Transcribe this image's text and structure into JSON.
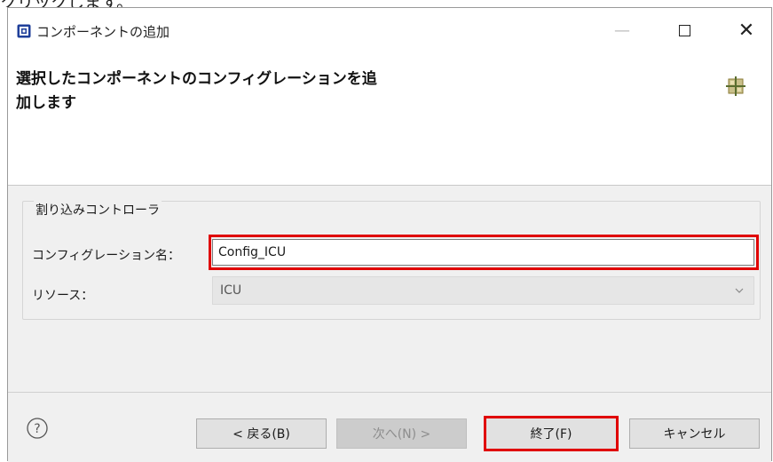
{
  "top_cut_text": "クリックします。",
  "window": {
    "title": "コンポーネントの追加",
    "minimize_symbol": "—",
    "close_symbol": "✕"
  },
  "header": {
    "title_line1": "選択したコンポーネントのコンフィグレーションを追",
    "title_line2": "加します"
  },
  "group": {
    "title": "割り込みコントローラ",
    "config_label": "コンフィグレーション名：",
    "config_value": "Config_ICU",
    "resource_label": "リソース：",
    "resource_value": "ICU"
  },
  "footer": {
    "back_label": "< 戻る(B)",
    "next_label": "次へ(N) >",
    "finish_label": "終了(F)",
    "cancel_label": "キャンセル"
  },
  "icons": [
    "app-icon",
    "minimize-icon",
    "maximize-icon",
    "close-icon",
    "component-grid-icon",
    "chevron-down-icon",
    "help-icon"
  ],
  "colors": {
    "highlight": "#e00000",
    "body_bg": "#f0f0f0",
    "button_bg": "#e1e1e1"
  }
}
